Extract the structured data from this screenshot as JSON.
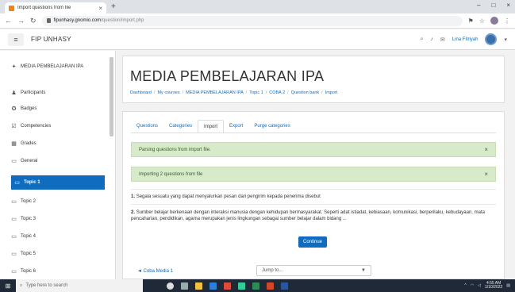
{
  "browser": {
    "tab_title": "Import questions from file",
    "url_host": "fipunhasy.gnomio.com",
    "url_path": "/question/import.php"
  },
  "navbar": {
    "brand": "FIP UNHASY",
    "user_name": "Lina Fitriyah"
  },
  "sidebar": {
    "items": [
      {
        "label": "MEDIA PEMBELAJARAN IPA",
        "icon": "graduation-cap-icon"
      },
      {
        "label": "Participants",
        "icon": "users-icon"
      },
      {
        "label": "Badges",
        "icon": "badge-icon"
      },
      {
        "label": "Competencies",
        "icon": "check-square-icon"
      },
      {
        "label": "Grades",
        "icon": "table-icon"
      },
      {
        "label": "General",
        "icon": "folder-icon"
      },
      {
        "label": "Topic 1",
        "icon": "folder-icon"
      },
      {
        "label": "Topic 2",
        "icon": "folder-icon"
      },
      {
        "label": "Topic 3",
        "icon": "folder-icon"
      },
      {
        "label": "Topic 4",
        "icon": "folder-icon"
      },
      {
        "label": "Topic 5",
        "icon": "folder-icon"
      },
      {
        "label": "Topic 6",
        "icon": "folder-icon"
      }
    ]
  },
  "header": {
    "title": "MEDIA PEMBELAJARAN IPA",
    "breadcrumb": [
      "Dashboard",
      "My courses",
      "MEDIA PEMBELAJARAN IPA",
      "Topic 1",
      "COBA 2",
      "Question bank",
      "Import"
    ]
  },
  "tabs": [
    {
      "label": "Questions"
    },
    {
      "label": "Categories"
    },
    {
      "label": "Import"
    },
    {
      "label": "Export"
    },
    {
      "label": "Purge categories"
    }
  ],
  "alerts": [
    {
      "text": "Parsing questions from import file."
    },
    {
      "text": "Importing 2 questions from file"
    }
  ],
  "questions": [
    {
      "num": "1.",
      "text": "Segala sesuatu yang dapat menyalurkan pesan dari pengirim kepada penerima disebut"
    },
    {
      "num": "2.",
      "text": "Sumber belajar berkenaan dengan interaksi manusia dengan kehidupan bermasyarakat. Seperti adat istiadat, kebiasaan, komunikasi, berperilaku, kebudayaan, mata pencaharian, pendidikan, agama merupakan jenis lingkungan sebagai sumber belajar dalam bidang ..."
    }
  ],
  "buttons": {
    "continue": "Continue"
  },
  "footer_nav": {
    "prev_link": "◄ Coba Media 1",
    "jump_placeholder": "Jump to..."
  },
  "taskbar": {
    "search_placeholder": "Type here to search",
    "time": "4:55 AM",
    "date": "1/10/2022"
  },
  "colors": {
    "accent": "#0f6cbf",
    "alert_bg": "#d7eac9"
  }
}
